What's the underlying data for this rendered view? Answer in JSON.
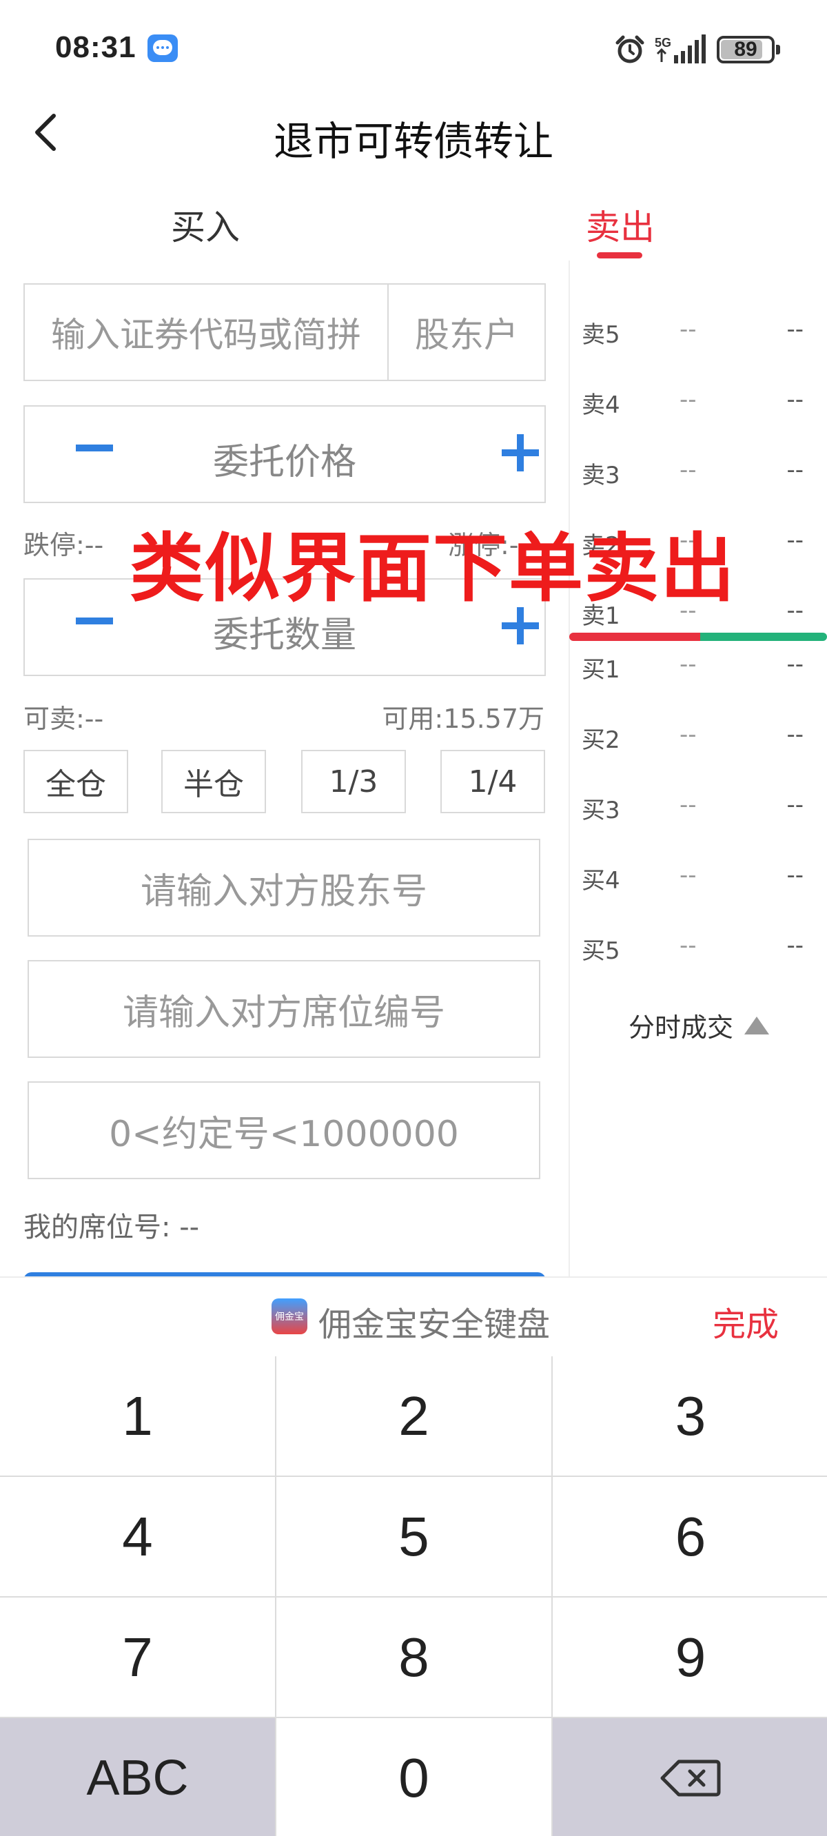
{
  "status_bar": {
    "time": "08:31",
    "network": "5G",
    "battery": "89"
  },
  "header": {
    "title": "退市可转债转让"
  },
  "tabs": [
    {
      "label": "买入",
      "active": false
    },
    {
      "label": "卖出",
      "active": true
    }
  ],
  "form": {
    "code_placeholder": "输入证券代码或简拼",
    "holder_label": "股东户",
    "price_placeholder": "委托价格",
    "limit_down": "跌停:--",
    "limit_up": "涨停:--",
    "quantity_placeholder": "委托数量",
    "sellable": "可卖:--",
    "available": "可用:15.57万",
    "position_buttons": [
      "全仓",
      "半仓",
      "1/3",
      "1/4"
    ],
    "counterparty_holder_placeholder": "请输入对方股东号",
    "counterparty_seat_placeholder": "请输入对方席位编号",
    "agreement_placeholder": "0<约定号<1000000",
    "my_seat_label": "我的席位号:",
    "my_seat_value": "--"
  },
  "overlay_text": "类似界面下单卖出",
  "order_book": {
    "asks": [
      {
        "label": "卖5",
        "price": "--",
        "volume": "--"
      },
      {
        "label": "卖4",
        "price": "--",
        "volume": "--"
      },
      {
        "label": "卖3",
        "price": "--",
        "volume": "--"
      },
      {
        "label": "卖2",
        "price": "--",
        "volume": "--"
      },
      {
        "label": "卖1",
        "price": "--",
        "volume": "--"
      }
    ],
    "bids": [
      {
        "label": "买1",
        "price": "--",
        "volume": "--"
      },
      {
        "label": "买2",
        "price": "--",
        "volume": "--"
      },
      {
        "label": "买3",
        "price": "--",
        "volume": "--"
      },
      {
        "label": "买4",
        "price": "--",
        "volume": "--"
      },
      {
        "label": "买5",
        "price": "--",
        "volume": "--"
      }
    ],
    "tick_toggle_label": "分时成交"
  },
  "keyboard": {
    "logo_text": "佣金宝",
    "title": "佣金宝安全键盘",
    "done_label": "完成",
    "keys": [
      "1",
      "2",
      "3",
      "4",
      "5",
      "6",
      "7",
      "8",
      "9",
      "ABC",
      "0"
    ]
  },
  "colors": {
    "accent_red": "#e8313f",
    "accent_blue": "#2f7fe0",
    "bid_green": "#23b27a",
    "overlay_red": "#ee1c1c"
  }
}
